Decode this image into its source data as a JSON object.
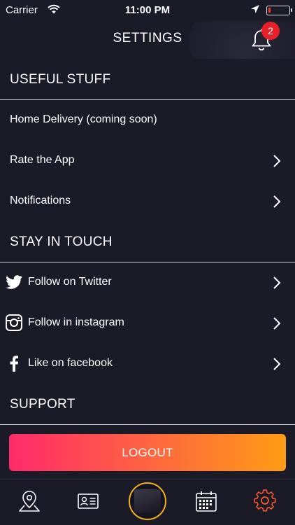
{
  "status_bar": {
    "carrier": "Carrier",
    "time": "11:00 PM",
    "battery_level": 0.12,
    "battery_color": "#ff3b30"
  },
  "header": {
    "title": "SETTINGS",
    "notification_count": "2",
    "badge_color": "#e8202a"
  },
  "sections": [
    {
      "title": "USEFUL STUFF",
      "items": [
        {
          "label": "Home Delivery (coming soon)",
          "icon": null,
          "chevron": false
        },
        {
          "label": "Rate the App",
          "icon": null,
          "chevron": true
        },
        {
          "label": "Notifications",
          "icon": null,
          "chevron": true
        }
      ]
    },
    {
      "title": "STAY IN TOUCH",
      "items": [
        {
          "label": "Follow on Twitter",
          "icon": "twitter-icon",
          "chevron": true
        },
        {
          "label": "Follow in instagram",
          "icon": "instagram-icon",
          "chevron": true
        },
        {
          "label": "Like on facebook",
          "icon": "facebook-icon",
          "chevron": true
        }
      ]
    },
    {
      "title": "SUPPORT",
      "items": []
    }
  ],
  "logout": {
    "label": "LOGOUT",
    "gradient": [
      "#ff2a6a",
      "#ff9c14"
    ]
  },
  "tabbar": {
    "tabs": [
      {
        "icon": "map-pin-icon",
        "active": false
      },
      {
        "icon": "id-card-icon",
        "active": false
      },
      {
        "icon": "home-image-icon",
        "active": false
      },
      {
        "icon": "calendar-icon",
        "active": false
      },
      {
        "icon": "gear-icon",
        "active": true
      }
    ],
    "active_color": "#ff5a2a",
    "center_ring_color": "#f2b01a"
  }
}
